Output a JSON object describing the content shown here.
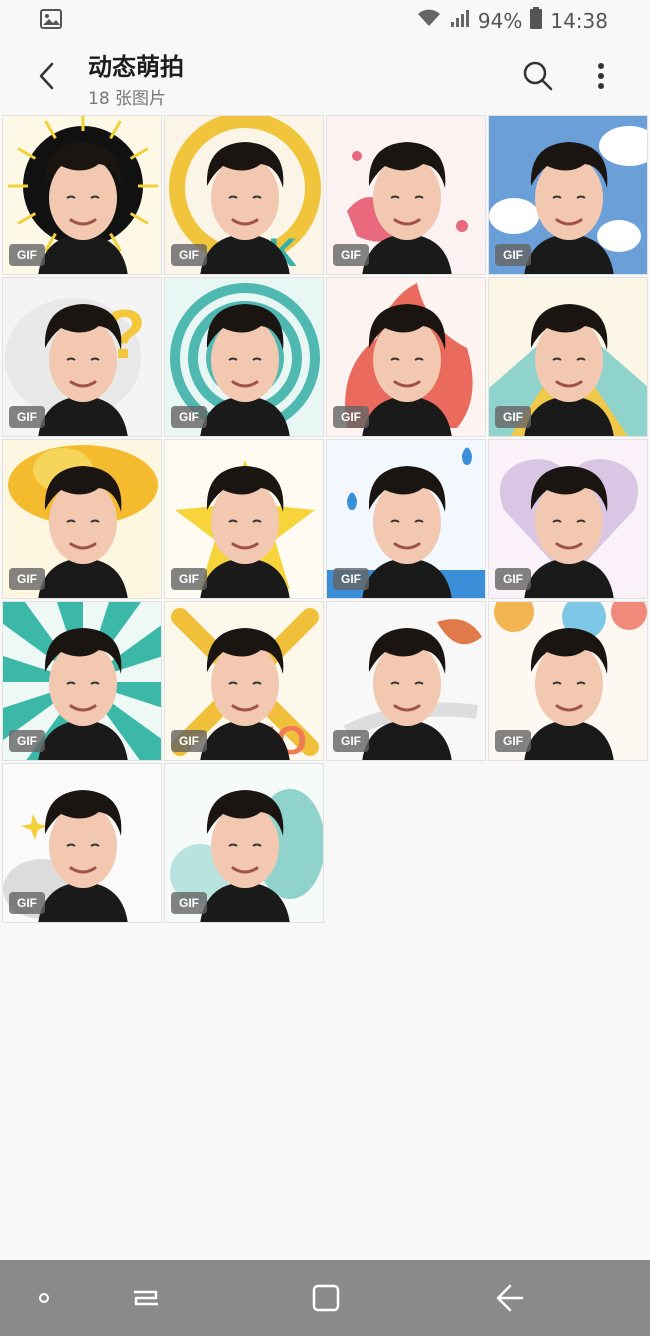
{
  "status": {
    "battery": "94%",
    "time": "14:38"
  },
  "header": {
    "title": "动态萌拍",
    "subtitle": "18 张图片"
  },
  "gif_label": "GIF",
  "tiles": [
    {
      "bg": "#fdf9e6",
      "accent": "#f2d13a",
      "deco": "burst"
    },
    {
      "bg": "#fbf5e8",
      "accent": "#f0c43b",
      "deco": "ok"
    },
    {
      "bg": "#fdf2f2",
      "accent": "#e86a7c",
      "deco": "kiss"
    },
    {
      "bg": "#6a9fd8",
      "accent": "#ffffff",
      "deco": "clouds"
    },
    {
      "bg": "#f4f4f4",
      "accent": "#f5c73a",
      "deco": "question"
    },
    {
      "bg": "#e8f6f4",
      "accent": "#4fb8b0",
      "deco": "rings"
    },
    {
      "bg": "#fdf4f1",
      "accent": "#ea6b5e",
      "deco": "fire"
    },
    {
      "bg": "#fbf6e6",
      "accent": "#f0c84a",
      "deco": "rainbow"
    },
    {
      "bg": "#fdf7e2",
      "accent": "#f3bb2d",
      "deco": "explosion"
    },
    {
      "bg": "#fefcf2",
      "accent": "#f6d43a",
      "deco": "star"
    },
    {
      "bg": "#f2f8fd",
      "accent": "#3b8fd8",
      "deco": "water"
    },
    {
      "bg": "#faf2f8",
      "accent": "#d9c6e4",
      "deco": "heart"
    },
    {
      "bg": "#eef8f4",
      "accent": "#3bb8a8",
      "deco": "rays"
    },
    {
      "bg": "#fdf8ec",
      "accent": "#f0c03a",
      "deco": "no"
    },
    {
      "bg": "#f8f8f8",
      "accent": "#e07a4b",
      "deco": "wind"
    },
    {
      "bg": "#fdf8f2",
      "accent": "#f2b552",
      "deco": "balloons"
    },
    {
      "bg": "#fafafa",
      "accent": "#dcdcdc",
      "deco": "smoke"
    },
    {
      "bg": "#f6faf9",
      "accent": "#8fd3cc",
      "deco": "ghost"
    }
  ]
}
